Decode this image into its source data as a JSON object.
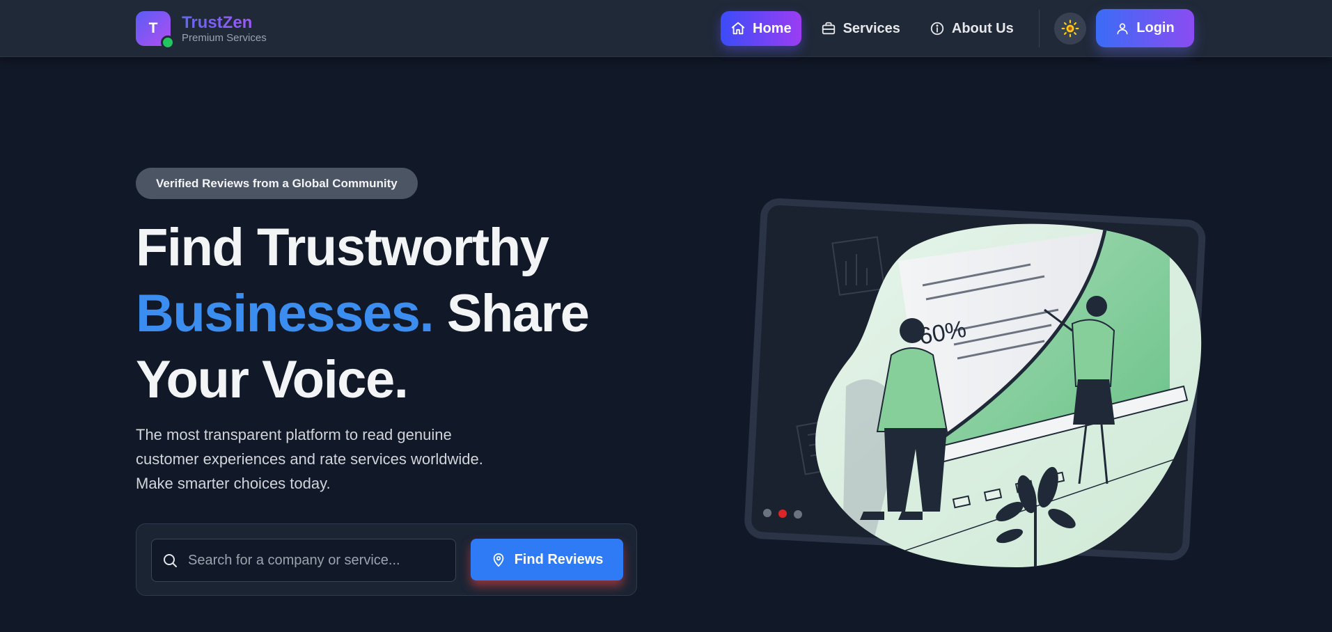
{
  "brand": {
    "logo_letter": "T",
    "name": "TrustZen",
    "subtitle": "Premium Services"
  },
  "nav": {
    "items": [
      {
        "label": "Home",
        "icon": "home-icon",
        "active": true
      },
      {
        "label": "Services",
        "icon": "briefcase-icon",
        "active": false
      },
      {
        "label": "About Us",
        "icon": "info-icon",
        "active": false
      }
    ],
    "theme_toggle_icon": "sun-icon",
    "login_label": "Login"
  },
  "hero": {
    "badge": "Verified Reviews from a Global Community",
    "title_line1": "Find Trustworthy",
    "title_accent": "Businesses.",
    "title_rest": " Share",
    "title_line3": "Your Voice.",
    "description": "The most transparent platform to read genuine customer experiences and rate services worldwide. Make smarter choices today."
  },
  "search": {
    "placeholder": "Search for a company or service...",
    "value": "",
    "button_label": "Find Reviews"
  },
  "illustration": {
    "chart_label": "60%",
    "carousel_dots": 3,
    "carousel_active_index": 1
  },
  "colors": {
    "background": "#111827",
    "navbar": "#1f2937",
    "accent_blue": "#3b8df0",
    "brand_purple": "#8b5cf6",
    "success_green": "#22c55e",
    "carousel_active": "#dc2626"
  }
}
